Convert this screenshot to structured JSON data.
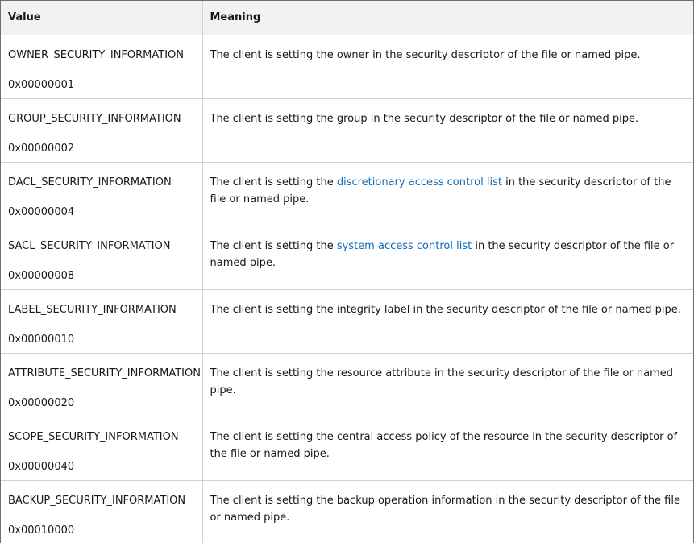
{
  "table": {
    "headers": [
      "Value",
      "Meaning"
    ],
    "rows": [
      {
        "name": "OWNER_SECURITY_INFORMATION",
        "hex": "0x00000001",
        "meaning_before": "The client is setting the owner in the security descriptor of the file or named pipe.",
        "link": "",
        "meaning_after": ""
      },
      {
        "name": "GROUP_SECURITY_INFORMATION",
        "hex": "0x00000002",
        "meaning_before": "The client is setting the group in the security descriptor of the file or named pipe.",
        "link": "",
        "meaning_after": ""
      },
      {
        "name": "DACL_SECURITY_INFORMATION",
        "hex": "0x00000004",
        "meaning_before": "The client is setting the ",
        "link": "discretionary access control list",
        "meaning_after": " in the security descriptor of the file or named pipe."
      },
      {
        "name": "SACL_SECURITY_INFORMATION",
        "hex": "0x00000008",
        "meaning_before": "The client is setting the ",
        "link": "system access control list",
        "meaning_after": " in the security descriptor of the file or named pipe."
      },
      {
        "name": "LABEL_SECURITY_INFORMATION",
        "hex": "0x00000010",
        "meaning_before": "The client is setting the integrity label in the security descriptor of the file or named pipe.",
        "link": "",
        "meaning_after": ""
      },
      {
        "name": "ATTRIBUTE_SECURITY_INFORMATION",
        "hex": "0x00000020",
        "meaning_before": "The client is setting the resource attribute in the security descriptor of the file or named pipe.",
        "link": "",
        "meaning_after": ""
      },
      {
        "name": "SCOPE_SECURITY_INFORMATION",
        "hex": "0x00000040",
        "meaning_before": "The client is setting the central access policy of the resource in the security descriptor of the file or named pipe.",
        "link": "",
        "meaning_after": ""
      },
      {
        "name": "BACKUP_SECURITY_INFORMATION",
        "hex": "0x00010000",
        "meaning_before": "The client is setting the backup operation information in the security descriptor of the file or named pipe.",
        "link": "",
        "meaning_after": ""
      }
    ]
  },
  "colors": {
    "link": "#0f6cbd",
    "header_bg": "#f2f2f2",
    "border": "#d1d1d1",
    "text": "#171717"
  }
}
